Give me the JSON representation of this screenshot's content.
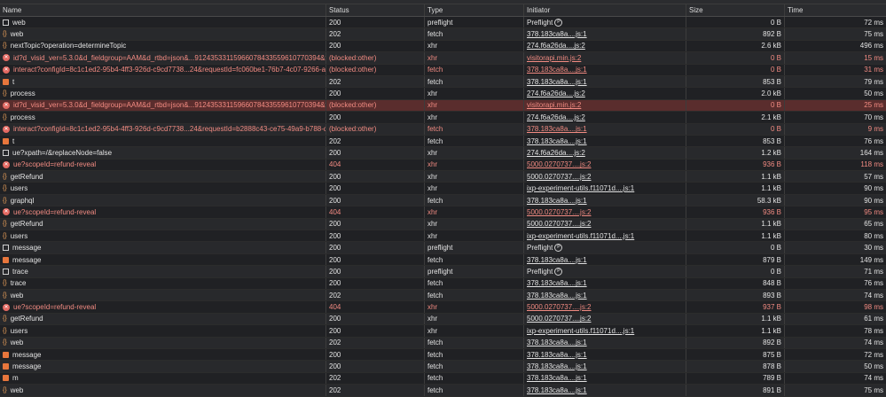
{
  "columns": {
    "name": "Name",
    "status": "Status",
    "type": "Type",
    "initiator": "Initiator",
    "size": "Size",
    "time": "Time"
  },
  "rows": [
    {
      "icon": "doc",
      "name": "web",
      "status": "200",
      "type": "preflight",
      "initiator": "Preflight",
      "size": "0 B",
      "time": "72 ms"
    },
    {
      "icon": "xhr",
      "name": "web",
      "status": "202",
      "type": "fetch",
      "initiator": "378.183ca8a....js:1",
      "size": "892 B",
      "time": "75 ms"
    },
    {
      "icon": "xhr",
      "name": "nextTopic?operation=determineTopic",
      "status": "200",
      "type": "xhr",
      "initiator": "274.f6a26da....js:2",
      "size": "2.6 kB",
      "time": "496 ms"
    },
    {
      "icon": "err",
      "name": "id?d_visid_ver=5.3.0&d_fieldgroup=AAM&d_rtbd=json&...91243533115966078433559610770394&ts=17396831...",
      "status": "(blocked:other)",
      "type": "xhr",
      "initiator": "visitorapi.min.js:2",
      "size": "0 B",
      "time": "15 ms"
    },
    {
      "icon": "err",
      "name": "interact?configId=8c1c1ed2-95b4-4ff3-926d-c9cd7738...24&requestId=fc060be1-76b7-4c07-9266-a86c4faedfa4",
      "status": "(blocked:other)",
      "type": "fetch",
      "initiator": "378.183ca8a....js:1",
      "size": "0 B",
      "time": "31 ms"
    },
    {
      "icon": "msg",
      "name": "t",
      "status": "202",
      "type": "fetch",
      "initiator": "378.183ca8a....js:1",
      "size": "853 B",
      "time": "79 ms"
    },
    {
      "icon": "xhr",
      "name": "process",
      "status": "200",
      "type": "xhr",
      "initiator": "274.f6a26da....js:2",
      "size": "2.0 kB",
      "time": "50 ms"
    },
    {
      "icon": "err",
      "name": "id?d_visid_ver=5.3.0&d_fieldgroup=AAM&d_rtbd=json&...91243533115966078433559610770394&ts=17396831...",
      "status": "(blocked:other)",
      "type": "xhr",
      "initiator": "visitorapi.min.js:2",
      "size": "0 B",
      "time": "25 ms"
    },
    {
      "icon": "xhr",
      "name": "process",
      "status": "200",
      "type": "xhr",
      "initiator": "274.f6a26da....js:2",
      "size": "2.1 kB",
      "time": "70 ms"
    },
    {
      "icon": "err",
      "name": "interact?configId=8c1c1ed2-95b4-4ff3-926d-c9cd7738...24&requestId=b2888c43-ce75-49a9-b788-dc314c7188b2",
      "status": "(blocked:other)",
      "type": "fetch",
      "initiator": "378.183ca8a....js:1",
      "size": "0 B",
      "time": "9 ms"
    },
    {
      "icon": "msg",
      "name": "t",
      "status": "202",
      "type": "fetch",
      "initiator": "378.183ca8a....js:1",
      "size": "853 B",
      "time": "76 ms"
    },
    {
      "icon": "doc",
      "name": "ue?xpath=/&replaceNode=false",
      "status": "200",
      "type": "xhr",
      "initiator": "274.f6a26da....js:2",
      "size": "1.2 kB",
      "time": "164 ms"
    },
    {
      "icon": "err",
      "name": "ue?scopeId=refund-reveal",
      "status": "404",
      "type": "xhr",
      "initiator": "5000.0270737....js:2",
      "size": "936 B",
      "time": "118 ms"
    },
    {
      "icon": "xhr",
      "name": "getRefund",
      "status": "200",
      "type": "xhr",
      "initiator": "5000.0270737....js:2",
      "size": "1.1 kB",
      "time": "57 ms"
    },
    {
      "icon": "xhr",
      "name": "users",
      "status": "200",
      "type": "xhr",
      "initiator": "ixp-experiment-utils.f11071d....js:1",
      "size": "1.1 kB",
      "time": "90 ms"
    },
    {
      "icon": "xhr",
      "name": "graphql",
      "status": "200",
      "type": "fetch",
      "initiator": "378.183ca8a....js:1",
      "size": "58.3 kB",
      "time": "90 ms"
    },
    {
      "icon": "err",
      "name": "ue?scopeId=refund-reveal",
      "status": "404",
      "type": "xhr",
      "initiator": "5000.0270737....js:2",
      "size": "936 B",
      "time": "95 ms"
    },
    {
      "icon": "xhr",
      "name": "getRefund",
      "status": "200",
      "type": "xhr",
      "initiator": "5000.0270737....js:2",
      "size": "1.1 kB",
      "time": "65 ms"
    },
    {
      "icon": "xhr",
      "name": "users",
      "status": "200",
      "type": "xhr",
      "initiator": "ixp-experiment-utils.f11071d....js:1",
      "size": "1.1 kB",
      "time": "80 ms"
    },
    {
      "icon": "doc",
      "name": "message",
      "status": "200",
      "type": "preflight",
      "initiator": "Preflight",
      "size": "0 B",
      "time": "30 ms"
    },
    {
      "icon": "msg",
      "name": "message",
      "status": "200",
      "type": "fetch",
      "initiator": "378.183ca8a....js:1",
      "size": "879 B",
      "time": "149 ms"
    },
    {
      "icon": "doc",
      "name": "trace",
      "status": "200",
      "type": "preflight",
      "initiator": "Preflight",
      "size": "0 B",
      "time": "71 ms"
    },
    {
      "icon": "xhr",
      "name": "trace",
      "status": "200",
      "type": "fetch",
      "initiator": "378.183ca8a....js:1",
      "size": "848 B",
      "time": "76 ms"
    },
    {
      "icon": "xhr",
      "name": "web",
      "status": "202",
      "type": "fetch",
      "initiator": "378.183ca8a....js:1",
      "size": "893 B",
      "time": "74 ms"
    },
    {
      "icon": "err",
      "name": "ue?scopeId=refund-reveal",
      "status": "404",
      "type": "xhr",
      "initiator": "5000.0270737....js:2",
      "size": "937 B",
      "time": "98 ms"
    },
    {
      "icon": "xhr",
      "name": "getRefund",
      "status": "200",
      "type": "xhr",
      "initiator": "5000.0270737....js:2",
      "size": "1.1 kB",
      "time": "61 ms"
    },
    {
      "icon": "xhr",
      "name": "users",
      "status": "200",
      "type": "xhr",
      "initiator": "ixp-experiment-utils.f11071d....js:1",
      "size": "1.1 kB",
      "time": "78 ms"
    },
    {
      "icon": "xhr",
      "name": "web",
      "status": "202",
      "type": "fetch",
      "initiator": "378.183ca8a....js:1",
      "size": "892 B",
      "time": "74 ms"
    },
    {
      "icon": "msg",
      "name": "message",
      "status": "200",
      "type": "fetch",
      "initiator": "378.183ca8a....js:1",
      "size": "875 B",
      "time": "72 ms"
    },
    {
      "icon": "msg",
      "name": "message",
      "status": "200",
      "type": "fetch",
      "initiator": "378.183ca8a....js:1",
      "size": "878 B",
      "time": "50 ms"
    },
    {
      "icon": "msg",
      "name": "m",
      "status": "202",
      "type": "fetch",
      "initiator": "378.183ca8a....js:1",
      "size": "789 B",
      "time": "74 ms"
    },
    {
      "icon": "xhr",
      "name": "web",
      "status": "202",
      "type": "fetch",
      "initiator": "378.183ca8a....js:1",
      "size": "891 B",
      "time": "75 ms"
    }
  ],
  "selected_row": 7
}
